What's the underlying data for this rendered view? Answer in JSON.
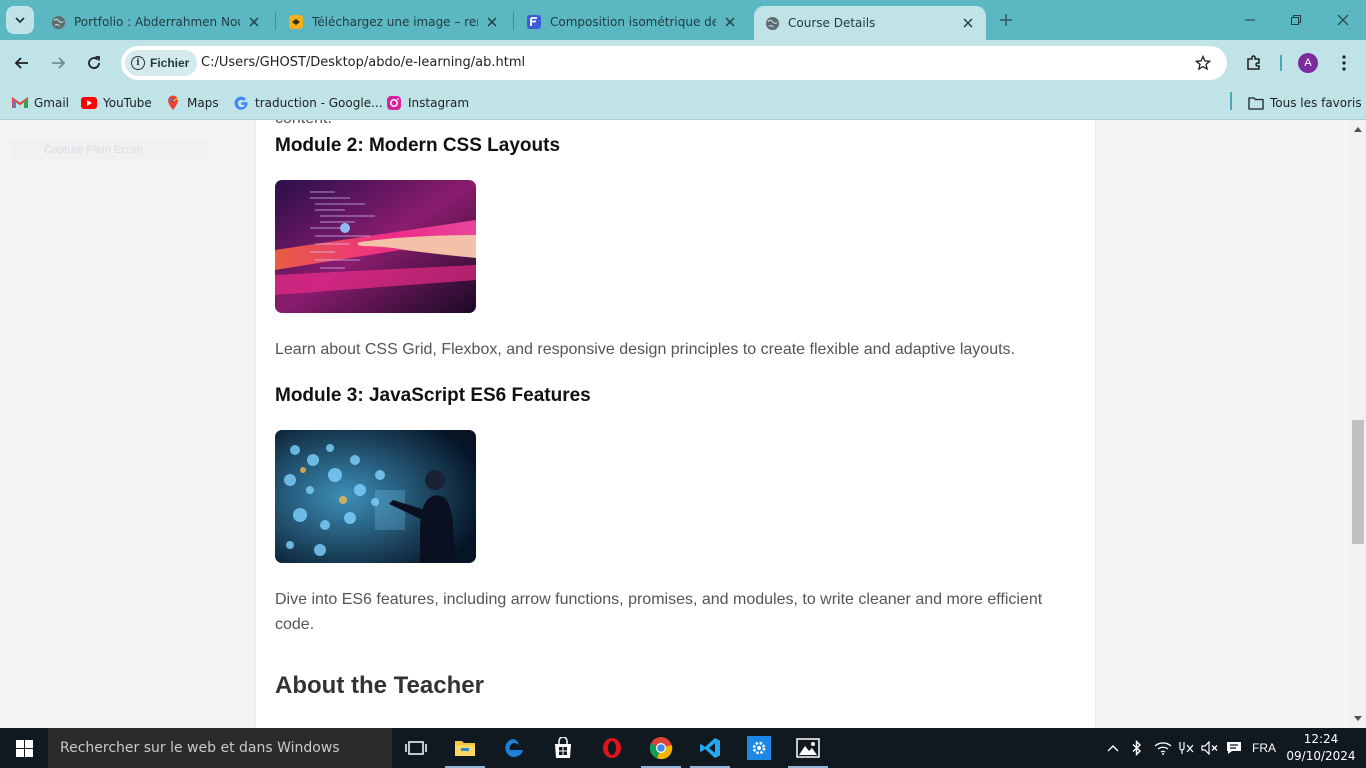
{
  "browser": {
    "tabs": [
      {
        "title": "Portfolio : Abderrahmen Nouali",
        "active": false
      },
      {
        "title": "Téléchargez une image – remove",
        "active": false
      },
      {
        "title": "Composition isométrique de de",
        "active": false
      },
      {
        "title": "Course Details",
        "active": true
      }
    ],
    "address": {
      "chip_label": "Fichier",
      "url": "C:/Users/GHOST/Desktop/abdo/e-learning/ab.html"
    },
    "profile_initial": "A",
    "bookmarks": [
      {
        "label": "Gmail",
        "icon": "gmail-icon"
      },
      {
        "label": "YouTube",
        "icon": "youtube-icon"
      },
      {
        "label": "Maps",
        "icon": "maps-icon"
      },
      {
        "label": "traduction - Google...",
        "icon": "google-icon"
      },
      {
        "label": "Instagram",
        "icon": "instagram-icon"
      }
    ],
    "all_bookmarks_label": "Tous les favoris"
  },
  "page": {
    "sidebar_ghost_text": "Capture Plein Ecran",
    "cut_off_text": "content.",
    "modules": [
      {
        "title": "Module 2: Modern CSS Layouts",
        "image": "code-hand-image",
        "description": "Learn about CSS Grid, Flexbox, and responsive design principles to create flexible and adaptive layouts."
      },
      {
        "title": "Module 3: JavaScript ES6 Features",
        "image": "futuristic-interface-image",
        "description": "Dive into ES6 features, including arrow functions, promises, and modules, to write cleaner and more efficient code."
      }
    ],
    "about_title": "About the Teacher"
  },
  "taskbar": {
    "search_placeholder": "Rechercher sur le web et dans Windows",
    "apps": [
      "task-view",
      "file-explorer",
      "edge",
      "store",
      "opera",
      "chrome",
      "vscode",
      "settings",
      "photos"
    ],
    "language": "FRA",
    "time": "12:24",
    "date": "09/10/2024"
  },
  "colors": {
    "tabstrip": "#5bb8c2",
    "toolbar": "#bfe3e7",
    "page_bg": "#f4f4f4",
    "card_bg": "#ffffff",
    "taskbar": "#101820"
  }
}
